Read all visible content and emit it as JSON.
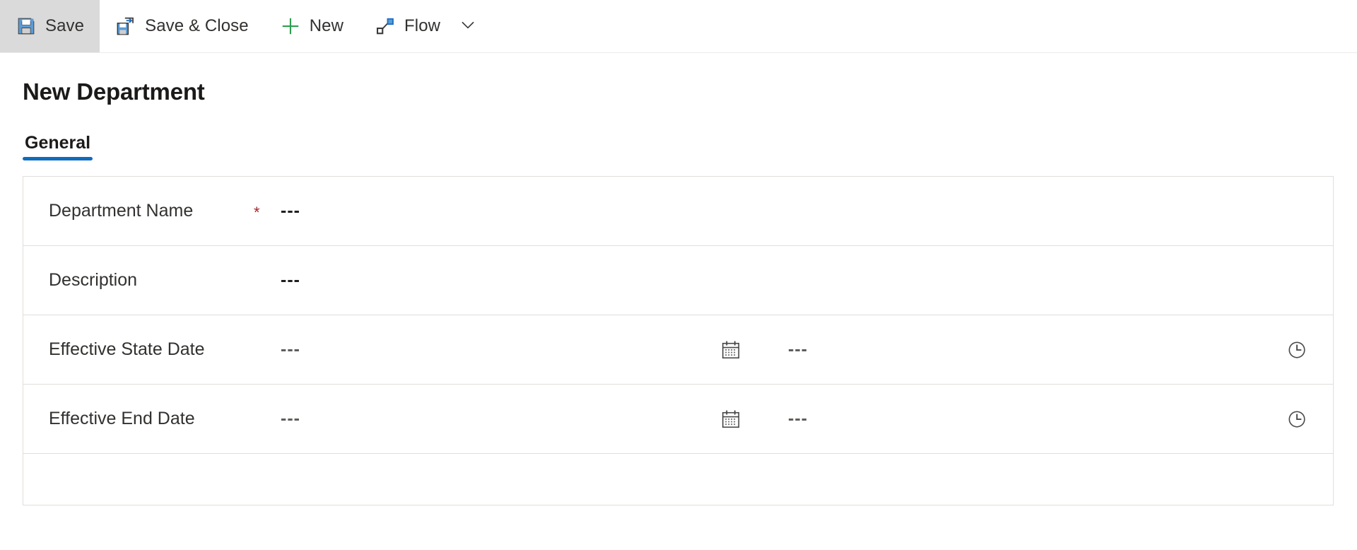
{
  "commandbar": {
    "items": [
      {
        "label": "Save",
        "icon": "save-icon",
        "active": true,
        "name": "save"
      },
      {
        "label": "Save & Close",
        "icon": "save-and-close-icon",
        "active": false,
        "name": "save-and-close"
      },
      {
        "label": "New",
        "icon": "plus-icon",
        "active": false,
        "name": "new"
      },
      {
        "label": "Flow",
        "icon": "flow-icon",
        "active": false,
        "name": "flow"
      }
    ],
    "overflow_chevron": "chevron-down-icon"
  },
  "page": {
    "title": "New Department"
  },
  "tabs": [
    {
      "label": "General",
      "selected": true
    }
  ],
  "form": {
    "rows": [
      {
        "label": "Department Name",
        "required": "*",
        "value": "---",
        "type": "text"
      },
      {
        "label": "Description",
        "required": "",
        "value": "---",
        "type": "text"
      },
      {
        "label": "Effective State Date",
        "required": "",
        "value": "---",
        "time_value": "---",
        "type": "datetime",
        "date_icon": "calendar-icon",
        "time_icon": "clock-icon"
      },
      {
        "label": "Effective End Date",
        "required": "",
        "value": "---",
        "time_value": "---",
        "type": "datetime",
        "date_icon": "calendar-icon",
        "time_icon": "clock-icon"
      }
    ]
  },
  "colors": {
    "accent": "#0f6cbd",
    "required": "#a4262c",
    "icon_blue": "#5b9bd5",
    "icon_green": "#2e9e4f",
    "toolbar_active_bg": "#dadada",
    "border": "#e1dfdd"
  }
}
